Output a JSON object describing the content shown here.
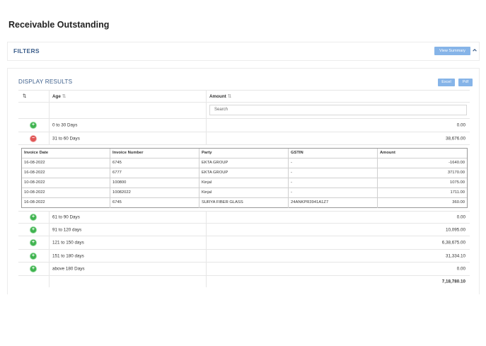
{
  "page": {
    "title": "Receivable Outstanding"
  },
  "filters": {
    "title": "FILTERS",
    "view_summary_label": "View Summary"
  },
  "results": {
    "title": "DISPLAY RESULTS",
    "excel_label": "Excel",
    "pdf_label": "Pdf",
    "columns": {
      "age": "Age",
      "amount": "Amount"
    },
    "search_placeholder": "Search",
    "rows": [
      {
        "age": "0 to 30 Days",
        "amount": "0.00",
        "state": "collapsed"
      },
      {
        "age": "31 to 60 Days",
        "amount": "38,676.00",
        "state": "expanded"
      },
      {
        "age": "61 to 90 Days",
        "amount": "0.00",
        "state": "collapsed"
      },
      {
        "age": "91 to 120 days",
        "amount": "10,095.00",
        "state": "collapsed"
      },
      {
        "age": "121 to 150 days",
        "amount": "6,38,675.00",
        "state": "collapsed"
      },
      {
        "age": "151 to 180 days",
        "amount": "31,334.10",
        "state": "collapsed"
      },
      {
        "age": "above 180 Days",
        "amount": "0.00",
        "state": "collapsed"
      }
    ],
    "total": "7,18,780.10"
  },
  "invoices": {
    "headers": [
      "Invoice Date",
      "Invoice Number",
      "Party",
      "GSTIN",
      "Amount"
    ],
    "rows": [
      [
        "16-08-2022",
        "6745",
        "EKTA GROUP",
        "-",
        "-1640.00"
      ],
      [
        "16-08-2022",
        "6777",
        "EKTA GROUP",
        "-",
        "37170.00"
      ],
      [
        "10-08-2022",
        "100800",
        "Kinjal",
        "-",
        "1075.00"
      ],
      [
        "10-08-2022",
        "10082022",
        "Kinjal",
        "-",
        "1711.00"
      ],
      [
        "16-08-2022",
        "6745",
        "SURYA FIBER GLASS",
        "24ANKPR3941A1Z7",
        "360.00"
      ]
    ]
  },
  "colors": {
    "accent": "#86b4e8",
    "heading": "#3d5f8c",
    "expand": "#3fb34f",
    "collapse": "#e05555"
  },
  "icons": {
    "expand": "plus-circle-icon",
    "collapse": "minus-circle-icon",
    "sort": "sort-icon",
    "chevron": "chevron-up-icon"
  }
}
